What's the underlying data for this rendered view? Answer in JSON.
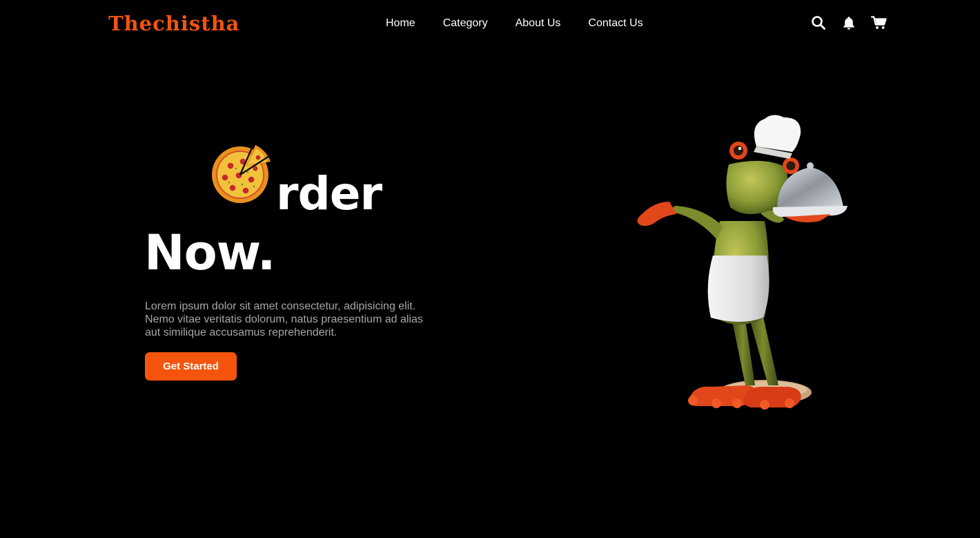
{
  "brand": {
    "logo_text": "Thechistha",
    "accent_color": "#f4540c"
  },
  "nav": {
    "links": [
      {
        "label": "Home"
      },
      {
        "label": "Category"
      },
      {
        "label": "About Us"
      },
      {
        "label": "Contact Us"
      }
    ],
    "icons": [
      "search-icon",
      "bell-icon",
      "cart-icon"
    ]
  },
  "hero": {
    "headline_line1_icon": "pizza-icon",
    "headline_line1_text": "rder",
    "headline_line2": "Now.",
    "description": "Lorem ipsum dolor sit amet consectetur, adipisicing elit. Nemo vitae veritatis dolorum, natus praesentium ad alias aut similique accusamus reprehenderit.",
    "cta_label": "Get Started",
    "image": "frog-chef-illustration"
  }
}
